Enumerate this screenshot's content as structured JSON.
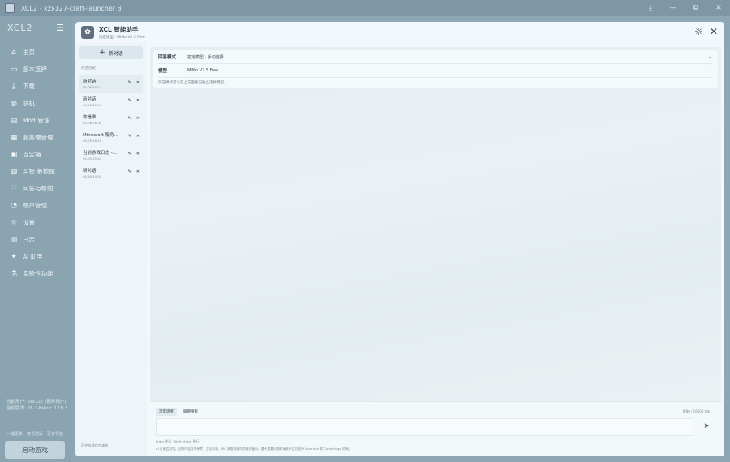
{
  "window": {
    "title": "XCL2 - xzx127-craft-launcher 3",
    "buttons": [
      "⤓",
      "—",
      "⧉",
      "✕"
    ]
  },
  "sidebar": {
    "logo": "XCL2",
    "items": [
      {
        "label": "主页",
        "icon": "⌂",
        "icon_name": "home-icon"
      },
      {
        "label": "版本选择",
        "icon": "▭",
        "icon_name": "folder-icon"
      },
      {
        "label": "下载",
        "icon": "⤓",
        "icon_name": "download-icon"
      },
      {
        "label": "联机",
        "icon": "◍",
        "icon_name": "globe-icon"
      },
      {
        "label": "Mod 管理",
        "icon": "▤",
        "icon_name": "mod-icon"
      },
      {
        "label": "服务端管理",
        "icon": "▦",
        "icon_name": "server-icon"
      },
      {
        "label": "百宝箱",
        "icon": "▣",
        "icon_name": "toolbox-icon"
      },
      {
        "label": "买智·慕校服",
        "icon": "▧",
        "icon_name": "skin-icon"
      },
      {
        "label": "问答与帮助",
        "icon": "♡",
        "icon_name": "help-icon"
      },
      {
        "label": "帐户管理",
        "icon": "◔",
        "icon_name": "user-icon"
      },
      {
        "label": "设置",
        "icon": "☼",
        "icon_name": "settings-icon"
      },
      {
        "label": "日志",
        "icon": "▥",
        "icon_name": "log-icon"
      },
      {
        "label": "AI 助手",
        "icon": "✦",
        "icon_name": "ai-icon"
      },
      {
        "label": "实验性功能",
        "icon": "⚗",
        "icon_name": "flask-icon"
      }
    ],
    "account_lines": [
      "当前用户: xzx127 (新鲜用户)",
      "当前版本: 26.2-Fabric 0.19.3"
    ],
    "account_links": [
      "一键更新",
      "查看附近",
      "更多导航"
    ],
    "launch_label": "启动游戏"
  },
  "assistant": {
    "title": "XCL 智能助手",
    "subtitle": "指定模型 · MiMo V2.5 Free",
    "new_chat_label": "新对话",
    "history_title": "对话历史",
    "history": [
      {
        "name": "新对话",
        "time": "05-06 20:12"
      },
      {
        "name": "新对话",
        "time": "05-06 15:34"
      },
      {
        "name": "你是谁",
        "time": "05-06 16:30"
      },
      {
        "name": "Minecraft 服务...",
        "time": "05-05 16:10"
      },
      {
        "name": "当前游戏日志 -...",
        "time": "05-05 15:44"
      },
      {
        "name": "新对话",
        "time": "04-30 10:55"
      }
    ],
    "history_footer": "历史仅保存在本机",
    "settings": [
      {
        "label": "回答模式",
        "value": "指定模型 · 手动选择"
      },
      {
        "label": "模型",
        "value": "MiMo V2.5 Free"
      }
    ],
    "settings_hint": "仅在模式可以在上方面板内独立选择模型。",
    "composer": {
      "tabs": [
        "深度思考",
        "联网搜索"
      ],
      "char_count": "0/86 / 16000 tok",
      "hint": "Enter 发送 · Shift+Enter 换行",
      "note": "AI 可能会犯错，回答内容仅供参考；涉及存档、MC 原版等操作前请先备份，遇不重复问题时请联系官方支持 Modrinth 和 CurseForge 资源。"
    }
  },
  "colors": {
    "accent": "#8aa4b2",
    "panel": "#f2f8fb"
  }
}
